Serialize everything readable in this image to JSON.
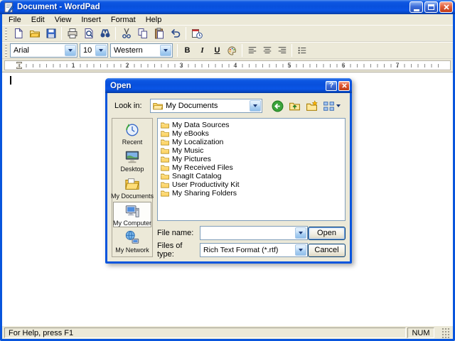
{
  "window": {
    "title": "Document - WordPad",
    "menu": [
      "File",
      "Edit",
      "View",
      "Insert",
      "Format",
      "Help"
    ],
    "toolbar_icons": [
      "new",
      "open",
      "save",
      "print",
      "print-preview",
      "find",
      "cut",
      "copy",
      "paste",
      "undo",
      "date-time"
    ],
    "format_bar": {
      "font": "Arial",
      "size": "10",
      "charset": "Western",
      "bold": "B",
      "italic": "I",
      "underline": "U",
      "align_icons": [
        "align-left",
        "align-center",
        "align-right"
      ],
      "bullets_icon": "bullets"
    },
    "ruler_marks": [
      "1",
      "2",
      "3",
      "4",
      "5",
      "6",
      "7"
    ],
    "status": {
      "help": "For Help, press F1",
      "num": "NUM"
    }
  },
  "dialog": {
    "title": "Open",
    "help_glyph": "?",
    "look_in_label": "Look in:",
    "look_in_value": "My Documents",
    "toolbar_icons": [
      "back",
      "up-one-level",
      "create-new-folder",
      "view-menu"
    ],
    "places": [
      {
        "label": "Recent",
        "icon": "recent-icon"
      },
      {
        "label": "Desktop",
        "icon": "desktop-icon"
      },
      {
        "label": "My Documents",
        "icon": "my-documents-icon"
      },
      {
        "label": "My Computer",
        "icon": "my-computer-icon",
        "selected": true
      },
      {
        "label": "My Network",
        "icon": "my-network-icon"
      }
    ],
    "files": [
      {
        "name": "My Data Sources",
        "icon": "folder-icon"
      },
      {
        "name": "My eBooks",
        "icon": "folder-icon"
      },
      {
        "name": "My Localization",
        "icon": "folder-icon"
      },
      {
        "name": "My Music",
        "icon": "folder-icon"
      },
      {
        "name": "My Pictures",
        "icon": "folder-icon"
      },
      {
        "name": "My Received Files",
        "icon": "folder-icon"
      },
      {
        "name": "SnagIt Catalog",
        "icon": "folder-icon"
      },
      {
        "name": "User Productivity Kit",
        "icon": "folder-icon"
      },
      {
        "name": "My Sharing Folders",
        "icon": "folder-icon"
      }
    ],
    "file_name_label": "File name:",
    "file_name_value": "",
    "files_of_type_label": "Files of type:",
    "files_of_type_value": "Rich Text Format (*.rtf)",
    "open_label": "Open",
    "cancel_label": "Cancel"
  },
  "colors": {
    "titlebar_blue": "#0855DD",
    "face": "#ECE9D8",
    "field_border": "#7F9DB9",
    "close_red": "#D4502C",
    "folder_yellow": "#FFD76E"
  }
}
